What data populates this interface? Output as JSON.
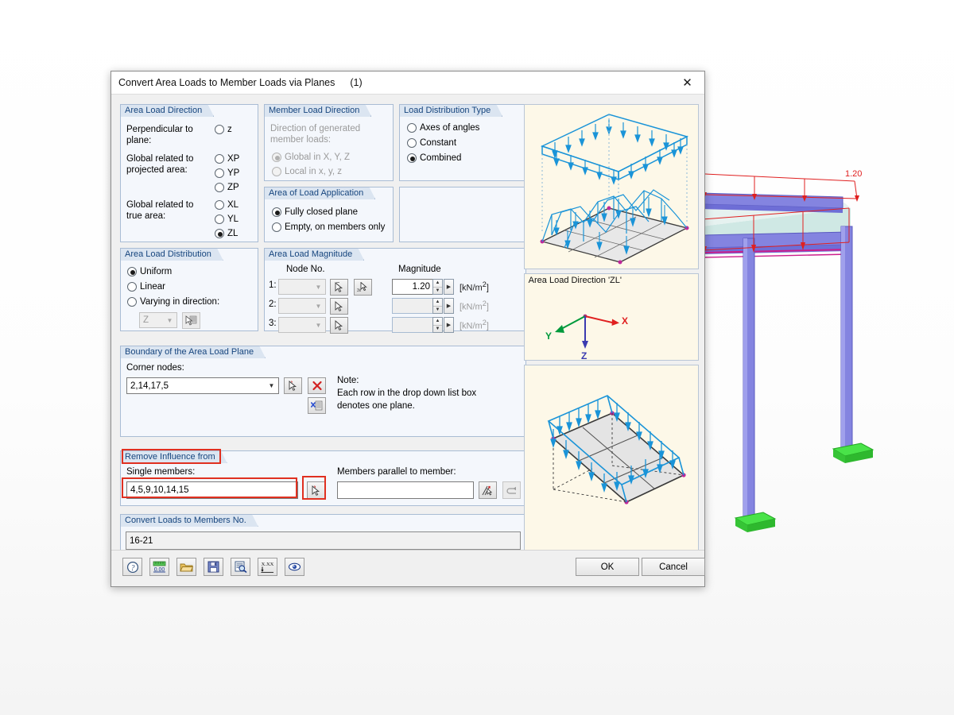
{
  "window": {
    "title": "Convert Area Loads to Member Loads via Planes",
    "instance": "(1)",
    "close_icon": "close-icon"
  },
  "area_load_direction": {
    "header": "Area Load Direction",
    "label_perpendicular": "Perpendicular to plane:",
    "label_projected": "Global related to projected area:",
    "label_true": "Global related to true area:",
    "options": [
      {
        "label": "z",
        "selected": false
      },
      {
        "label": "XP",
        "selected": false
      },
      {
        "label": "YP",
        "selected": false
      },
      {
        "label": "ZP",
        "selected": false
      },
      {
        "label": "XL",
        "selected": false
      },
      {
        "label": "YL",
        "selected": false
      },
      {
        "label": "ZL",
        "selected": true
      }
    ]
  },
  "member_load_direction": {
    "header": "Member Load Direction",
    "note": "Direction of generated member loads:",
    "disabled": true,
    "options": [
      {
        "label": "Global in X, Y, Z",
        "selected": true
      },
      {
        "label": "Local in x, y, z",
        "selected": false
      }
    ]
  },
  "area_of_load_application": {
    "header": "Area of Load Application",
    "options": [
      {
        "label": "Fully closed plane",
        "selected": true
      },
      {
        "label": "Empty, on members only",
        "selected": false
      }
    ]
  },
  "load_distribution_type": {
    "header": "Load Distribution Type",
    "options": [
      {
        "label": "Axes of angles",
        "selected": false
      },
      {
        "label": "Constant",
        "selected": false
      },
      {
        "label": "Combined",
        "selected": true
      }
    ]
  },
  "area_load_distribution": {
    "header": "Area Load Distribution",
    "options": [
      {
        "label": "Uniform",
        "selected": true
      },
      {
        "label": "Linear",
        "selected": false
      },
      {
        "label": "Varying in direction:",
        "selected": false
      }
    ],
    "direction_value": "Z",
    "direction_disabled": true,
    "pick_icon": "pick-direction-icon"
  },
  "area_load_magnitude": {
    "header": "Area Load Magnitude",
    "col_node": "Node No.",
    "col_magnitude": "Magnitude",
    "rows": [
      {
        "index": "1:",
        "node": "",
        "magnitude": "1.20",
        "unit": "[kN/m",
        "unit_sup": "2",
        "unit_end": "]",
        "disabled": false,
        "pick_icon": "pick-node-icon",
        "pick3_icon": "pick-3-nodes-icon"
      },
      {
        "index": "2:",
        "node": "",
        "magnitude": "",
        "unit": "[kN/m",
        "unit_sup": "2",
        "unit_end": "]",
        "disabled": true,
        "pick_icon": "pick-node-icon"
      },
      {
        "index": "3:",
        "node": "",
        "magnitude": "",
        "unit": "[kN/m",
        "unit_sup": "2",
        "unit_end": "]",
        "disabled": true,
        "pick_icon": "pick-node-icon"
      }
    ]
  },
  "boundary": {
    "header": "Boundary of the Area Load Plane",
    "corner_label": "Corner nodes:",
    "corner_value": "2,14,17,5",
    "pick_icon": "pick-nodes-icon",
    "delete_icon": "delete-red-x-icon",
    "list_icon": "clear-list-icon",
    "note_title": "Note:",
    "note_line1": "Each row in the drop down list box",
    "note_line2": "denotes one plane."
  },
  "remove_influence": {
    "header": "Remove Influence from",
    "single_label": "Single members:",
    "single_value": "4,5,9,10,14,15",
    "single_pick_icon": "pick-members-icon",
    "parallel_label": "Members parallel to member:",
    "parallel_value": "",
    "parallel_pick_icon": "pick-parallel-members-icon",
    "parallel_extra_icon": "apply-parallel-icon",
    "highlight_color": "#e03020"
  },
  "convert_loads": {
    "header": "Convert Loads to Members No.",
    "value": "16-21"
  },
  "toolbar": {
    "buttons": [
      {
        "name": "help-icon",
        "title": "Help"
      },
      {
        "name": "units-icon",
        "title": "Units and Decimal Places"
      },
      {
        "name": "open-folder-icon",
        "title": "Load"
      },
      {
        "name": "save-disk-icon",
        "title": "Save"
      },
      {
        "name": "preview-icon",
        "title": "Preview"
      },
      {
        "name": "xxx-icon",
        "title": "Values"
      },
      {
        "name": "eye-icon",
        "title": "Visibility"
      }
    ]
  },
  "dialog_buttons": {
    "ok": "OK",
    "cancel": "Cancel"
  },
  "preview": {
    "top_name": "load-distribution-preview",
    "direction_label": "Area Load Direction 'ZL'",
    "axes": [
      {
        "label": "X",
        "color": "#e02020"
      },
      {
        "label": "Y",
        "color": "#009a3c"
      },
      {
        "label": "Z",
        "color": "#3b3bb0"
      }
    ],
    "bottom_name": "closed-plane-preview"
  },
  "scene": {
    "load_value_label": "1.20",
    "load_color": "#e02020",
    "member_color": "#7b7bdb",
    "support_color": "#40e040",
    "surface_color": "#cfe8e4"
  }
}
